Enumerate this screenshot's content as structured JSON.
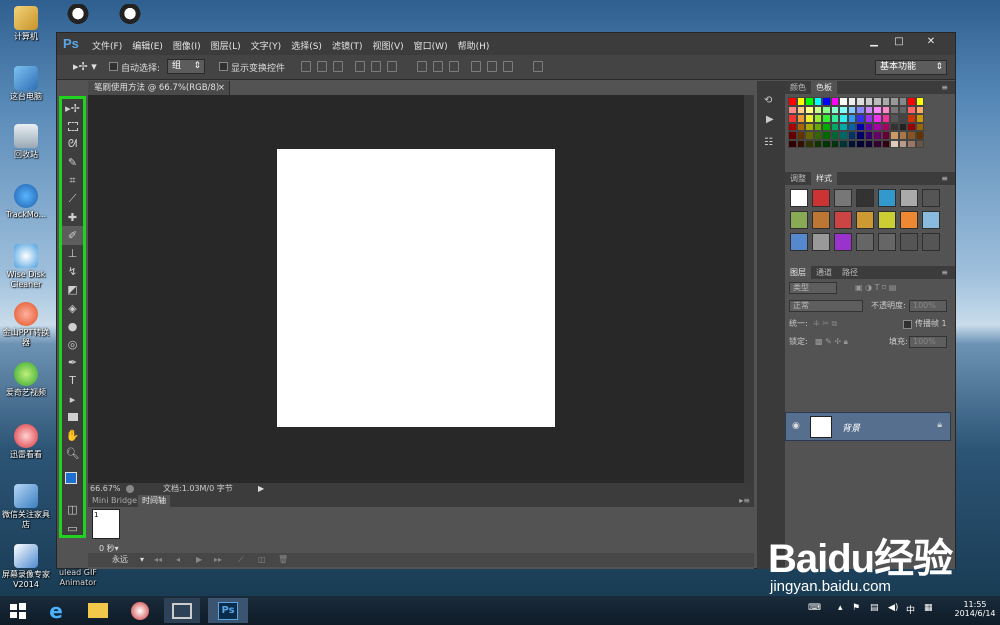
{
  "desktop": {
    "icons": [
      {
        "label": "计算机"
      },
      {
        "label": "这台电脑"
      },
      {
        "label": "回收站"
      },
      {
        "label": "TrackMo..."
      },
      {
        "label": "Wise Disk Cleaner"
      },
      {
        "label": "金山PPT转换器"
      },
      {
        "label": "爱奇艺视频"
      },
      {
        "label": "迅雷看看"
      },
      {
        "label": "微信关注家具店"
      },
      {
        "label": "屏幕录像专家V2014"
      },
      {
        "label": "ulead GIF Animator"
      }
    ]
  },
  "ps": {
    "logo": "Ps",
    "menu": [
      "文件(F)",
      "编辑(E)",
      "图像(I)",
      "图层(L)",
      "文字(Y)",
      "选择(S)",
      "滤镜(T)",
      "视图(V)",
      "窗口(W)",
      "帮助(H)"
    ],
    "window_buttons": {
      "min": "▁",
      "max": "□",
      "close": "✕"
    },
    "options": {
      "auto_select_label": "自动选择:",
      "auto_select_value": "组",
      "show_transform_label": "显示变换控件",
      "workspace": "基本功能"
    },
    "doc_tab": "笔刷使用方法 @ 66.7%(RGB/8)",
    "doc_tab_close": "×",
    "status": {
      "zoom": "66.67%",
      "doc_info": "文档:1.03M/0 字节"
    },
    "timeline": {
      "tab1": "Mini Bridge",
      "tab2": "时间轴",
      "frame_number": "1",
      "frame_delay": "0 秒▾",
      "loop": "永远"
    },
    "panels": {
      "color_tab": "颜色",
      "swatches_tab": "色板",
      "adjust_tab": "调整",
      "styles_tab": "样式",
      "layers_tab": "图层",
      "channels_tab": "通道",
      "paths_tab": "路径",
      "kind": "类型",
      "blend_mode": "正常",
      "opacity_label": "不透明度:",
      "opacity_value": "100%",
      "unify_label": "统一:",
      "propagate_label": "传播帧 1",
      "lock_label": "锁定:",
      "fill_label": "填充:",
      "fill_value": "100%",
      "layer_name": "背景"
    }
  },
  "colors": {
    "highlight_border": "#1fd31f",
    "foreground": "#1e6fd0",
    "background": "#ffffff"
  },
  "taskbar": {
    "time": "11:55",
    "date": "2014/6/14",
    "ime": "中"
  },
  "watermark": {
    "brand": "Baidu经验",
    "url": "jingyan.baidu.com"
  }
}
